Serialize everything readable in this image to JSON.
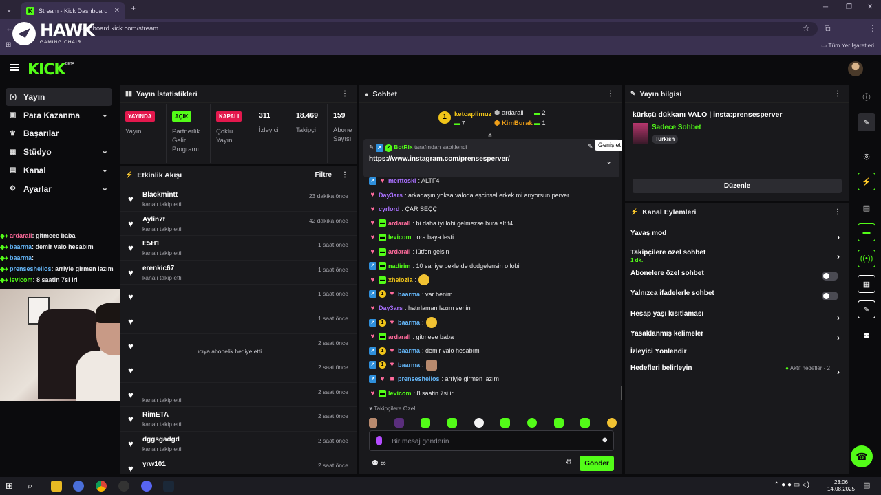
{
  "browser": {
    "tab_title": "Stream - Kick Dashboard",
    "tab_close": "✕",
    "new_tab": "+",
    "url": "dashboard.kick.com/stream",
    "bookmarks_label": "Tüm Yer İşaretleri"
  },
  "overlay_logo": {
    "word": "HAWK",
    "tagline": "GAMING CHAIR"
  },
  "kick": {
    "logo": "KICK",
    "beta": "BETA"
  },
  "sidebar": {
    "items": [
      {
        "label": "Yayın",
        "icon": "broadcast-icon",
        "glyph": "(•)",
        "active": true
      },
      {
        "label": "Para Kazanma",
        "icon": "money-icon",
        "glyph": "▣",
        "chevron": true
      },
      {
        "label": "Başarılar",
        "icon": "trophy-icon",
        "glyph": "♛"
      },
      {
        "label": "Stüdyo",
        "icon": "studio-icon",
        "glyph": "▦",
        "chevron": true
      },
      {
        "label": "Kanal",
        "icon": "channel-icon",
        "glyph": "▤",
        "chevron": true
      },
      {
        "label": "Ayarlar",
        "icon": "gear-icon",
        "glyph": "⚙",
        "chevron": true
      }
    ]
  },
  "overlay_chat": [
    {
      "user": "ardarall",
      "msg": ": gitmeee baba"
    },
    {
      "user": "baarma",
      "msg": ": demir valo hesabım"
    },
    {
      "user": "baarma",
      "msg": ":"
    },
    {
      "user": "prenseshelios",
      "msg": ": arriyle girmen lazım"
    },
    {
      "user": "levicom",
      "msg": ": 8 saatin 7si irl"
    }
  ],
  "stats": {
    "title": "Yayın İstatistikleri",
    "cols": [
      {
        "badge": "YAYINDA",
        "label": "Yayın"
      },
      {
        "badge": "AÇIK",
        "label": "Partnerlik Gelir Programı"
      },
      {
        "badge": "KAPALI",
        "label": "Çoklu Yayın"
      },
      {
        "num": "311",
        "label": "İzleyici"
      },
      {
        "num": "18.469",
        "label": "Takipçi"
      },
      {
        "num": "159",
        "label": "Abone Sayısı"
      }
    ]
  },
  "activity": {
    "title": "Etkinlik Akışı",
    "filter": "Filtre",
    "gift_fragment": "ıcıya abonelik hediye etti.",
    "rows": [
      {
        "name": "Blackmintt",
        "sub": "kanalı takip etti",
        "time": "23 dakika önce"
      },
      {
        "name": "Aylin7t",
        "sub": "kanalı takip etti",
        "time": "42 dakika önce"
      },
      {
        "name": "E5H1",
        "sub": "kanalı takip etti",
        "time": "1 saat önce"
      },
      {
        "name": "erenkic67",
        "sub": "kanalı takip etti",
        "time": "1 saat önce"
      },
      {
        "name": "",
        "sub": "",
        "time": "1 saat önce"
      },
      {
        "name": "",
        "sub": "",
        "time": "1 saat önce"
      },
      {
        "name": "",
        "sub": "",
        "time": "2 saat önce"
      },
      {
        "name": "",
        "sub": "",
        "time": "2 saat önce"
      },
      {
        "name": "",
        "sub": "kanalı takip etti",
        "time": "2 saat önce"
      },
      {
        "name": "RimETA",
        "sub": "kanalı takip etti",
        "time": "2 saat önce"
      },
      {
        "name": "dggsgadgd",
        "sub": "kanalı takip etti",
        "time": "2 saat önce"
      },
      {
        "name": "yrw101",
        "sub": "",
        "time": "2 saat önce"
      }
    ]
  },
  "chat": {
    "title": "Sohbet",
    "leaderboard": {
      "top": {
        "rank": "1",
        "name": "ketcaplimuz",
        "count": "7"
      },
      "second": {
        "name": "ardarall",
        "count": "2"
      },
      "third": {
        "name": "KimBurak",
        "count": "1"
      }
    },
    "pinned": {
      "by_user": "BotRix",
      "by_text": "tarafından sabitlendi",
      "link": "https://www.instagram.com/prensesperver/",
      "tooltip": "Genişlet"
    },
    "messages": [
      {
        "user": "merttoski",
        "color": "#a970ff",
        "msg": ": ALTF4",
        "badges": [
          "blue",
          "pink"
        ]
      },
      {
        "user": "Day3ars",
        "color": "#a970ff",
        "msg": ": arkadaşın yoksa valoda eşcinsel erkek mi arıyorsun perver",
        "badges": [
          "pink"
        ]
      },
      {
        "user": "cyrlord",
        "color": "#a970ff",
        "msg": ": ÇAR SEÇÇ",
        "badges": [
          "pink"
        ]
      },
      {
        "user": "ardarall",
        "color": "#ff6b9c",
        "msg": ": bi daha iyi lobi gelmezse bura alt f4",
        "badges": [
          "pink",
          "green"
        ]
      },
      {
        "user": "levicom",
        "color": "#53fc18",
        "msg": ": ora baya lesti",
        "badges": [
          "pink",
          "green"
        ]
      },
      {
        "user": "ardarall",
        "color": "#ff6b9c",
        "msg": ": lütfen gelsin",
        "badges": [
          "pink",
          "green"
        ]
      },
      {
        "user": "nadirim",
        "color": "#53fc18",
        "msg": ": 10 saniye bekle de dodgelensin o lobi",
        "badges": [
          "blue",
          "green"
        ]
      },
      {
        "user": "xhelozia",
        "color": "#f0c419",
        "msg": ":",
        "badges": [
          "pink",
          "green"
        ],
        "emote": "yellow"
      },
      {
        "user": "baarma",
        "color": "#64b5f6",
        "msg": ": var benim",
        "badges": [
          "blue",
          "gold",
          "pink"
        ]
      },
      {
        "user": "Day3ars",
        "color": "#a970ff",
        "msg": ": hatırlaman lazım senin",
        "badges": [
          "pink"
        ]
      },
      {
        "user": "baarma",
        "color": "#64b5f6",
        "msg": ":",
        "badges": [
          "blue",
          "gold",
          "pink"
        ],
        "emote": "yellow"
      },
      {
        "user": "ardarall",
        "color": "#ff6b9c",
        "msg": ": gitmeee baba",
        "badges": [
          "pink",
          "green"
        ]
      },
      {
        "user": "baarma",
        "color": "#64b5f6",
        "msg": ": demir valo hesabım",
        "badges": [
          "blue",
          "gold",
          "pink"
        ]
      },
      {
        "user": "baarma",
        "color": "#64b5f6",
        "msg": ":",
        "badges": [
          "blue",
          "gold",
          "pink"
        ],
        "emote": "face"
      },
      {
        "user": "prenseshelios",
        "color": "#64b5f6",
        "msg": ": arriyle girmen lazım",
        "badges": [
          "blue",
          "pink",
          "gift"
        ]
      },
      {
        "user": "levicom",
        "color": "#53fc18",
        "msg": ": 8 saatin 7si irl",
        "badges": [
          "pink",
          "green"
        ]
      }
    ],
    "quick_label": "Takipçilere Özel",
    "placeholder": "Bir mesaj gönderin",
    "send": "Gönder"
  },
  "stream_info": {
    "title": "Yayın bilgisi",
    "stream_title": "kürkçü dükkanı VALO | insta:prensesperver",
    "category": "Sadece Sohbet",
    "tag": "Turkish",
    "edit": "Düzenle"
  },
  "channel_actions": {
    "title": "Kanal Eylemleri",
    "rows": [
      {
        "label": "Yavaş mod",
        "type": "chevron"
      },
      {
        "label": "Takipçilere özel sohbet",
        "sub": "1 dk.",
        "type": "chevron"
      },
      {
        "label": "Abonelere özel sohbet",
        "type": "toggle"
      },
      {
        "label": "Yalnızca ifadelerle sohbet",
        "type": "toggle"
      },
      {
        "label": "Hesap yaşı kısıtlaması",
        "type": "chevron"
      },
      {
        "label": "Yasaklanmış kelimeler",
        "type": "chevron"
      },
      {
        "label": "İzleyici Yönlendir",
        "type": "none"
      },
      {
        "label": "Hedefleri belirleyin",
        "type": "chevron",
        "status": "Aktif hedefler - 2"
      }
    ]
  },
  "taskbar": {
    "time": "23:06",
    "date": "14.08.2025"
  },
  "colors": {
    "accent": "#53fc18",
    "live": "#e3184d",
    "panel": "#19191c"
  }
}
